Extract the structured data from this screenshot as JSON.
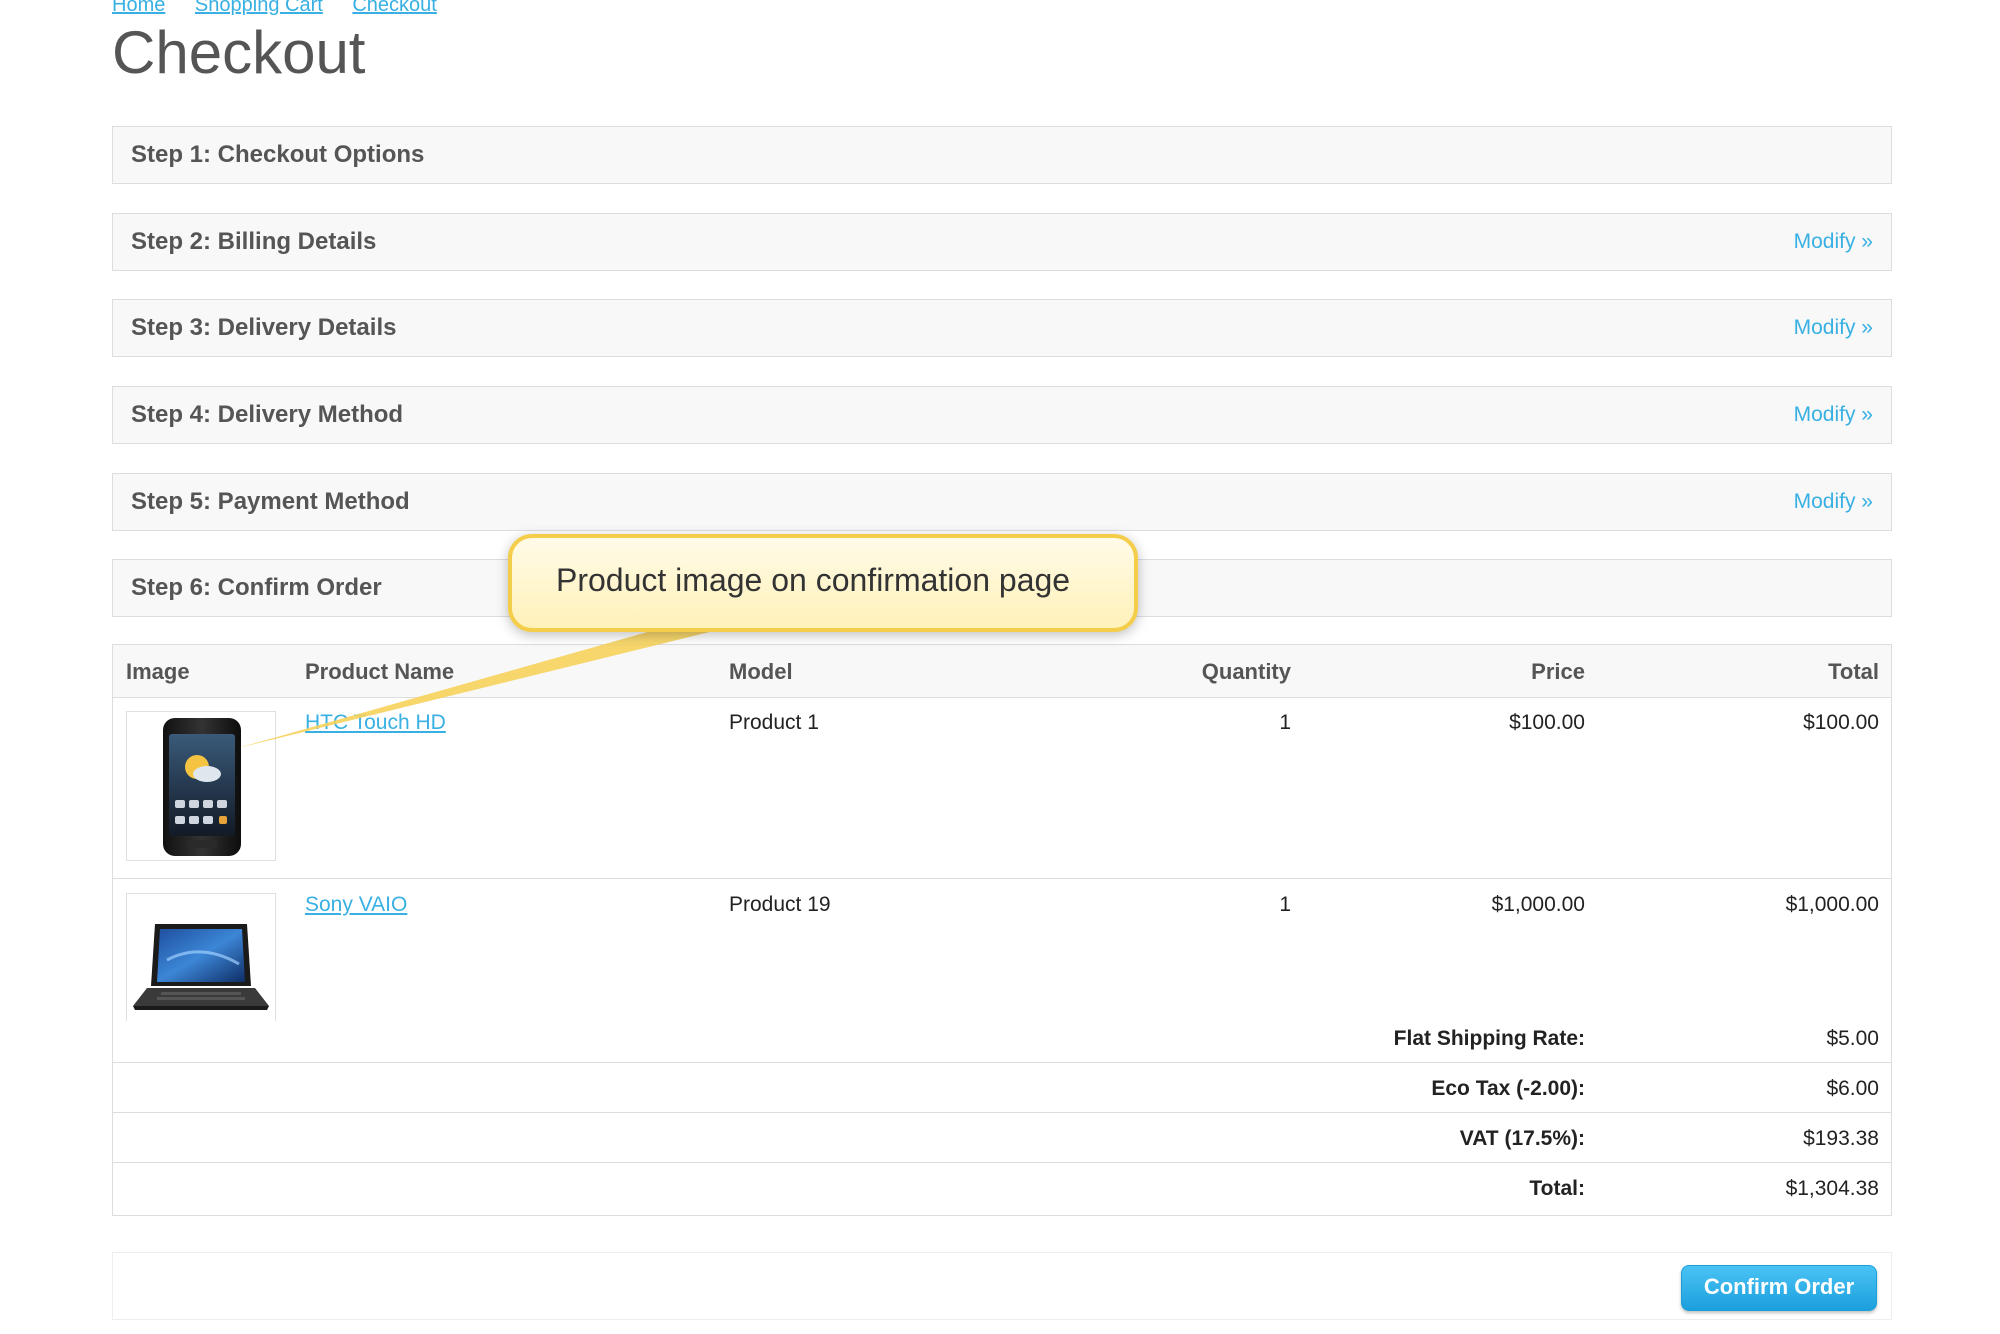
{
  "breadcrumb": {
    "items": [
      "Home",
      "Shopping Cart",
      "Checkout"
    ]
  },
  "page_title": "Checkout",
  "steps": [
    {
      "title": "Step 1: Checkout Options",
      "modify": ""
    },
    {
      "title": "Step 2: Billing Details",
      "modify": "Modify »"
    },
    {
      "title": "Step 3: Delivery Details",
      "modify": "Modify »"
    },
    {
      "title": "Step 4: Delivery Method",
      "modify": "Modify »"
    },
    {
      "title": "Step 5: Payment Method",
      "modify": "Modify »"
    },
    {
      "title": "Step 6: Confirm Order",
      "modify": ""
    }
  ],
  "cart": {
    "columns": [
      "Image",
      "Product Name",
      "Model",
      "Quantity",
      "Price",
      "Total"
    ],
    "items": [
      {
        "image": "phone-image",
        "name": "HTC Touch HD",
        "model": "Product 1",
        "quantity": "1",
        "price": "$100.00",
        "total": "$100.00"
      },
      {
        "image": "laptop-image",
        "name": "Sony VAIO",
        "model": "Product 19",
        "quantity": "1",
        "price": "$1,000.00",
        "total": "$1,000.00"
      }
    ],
    "totals": [
      {
        "label": "Flat Shipping Rate:",
        "value": "$5.00"
      },
      {
        "label": "Eco Tax (-2.00):",
        "value": "$6.00"
      },
      {
        "label": "VAT (17.5%):",
        "value": "$193.38"
      },
      {
        "label": "Total:",
        "value": "$1,304.38"
      }
    ]
  },
  "confirm_button": "Confirm Order",
  "callout": "Product image on confirmation page",
  "colors": {
    "link": "#38B0E3",
    "button": "#1C9FDD",
    "callout_fill": "#FFF8D6",
    "callout_border": "#F4CE4B"
  }
}
